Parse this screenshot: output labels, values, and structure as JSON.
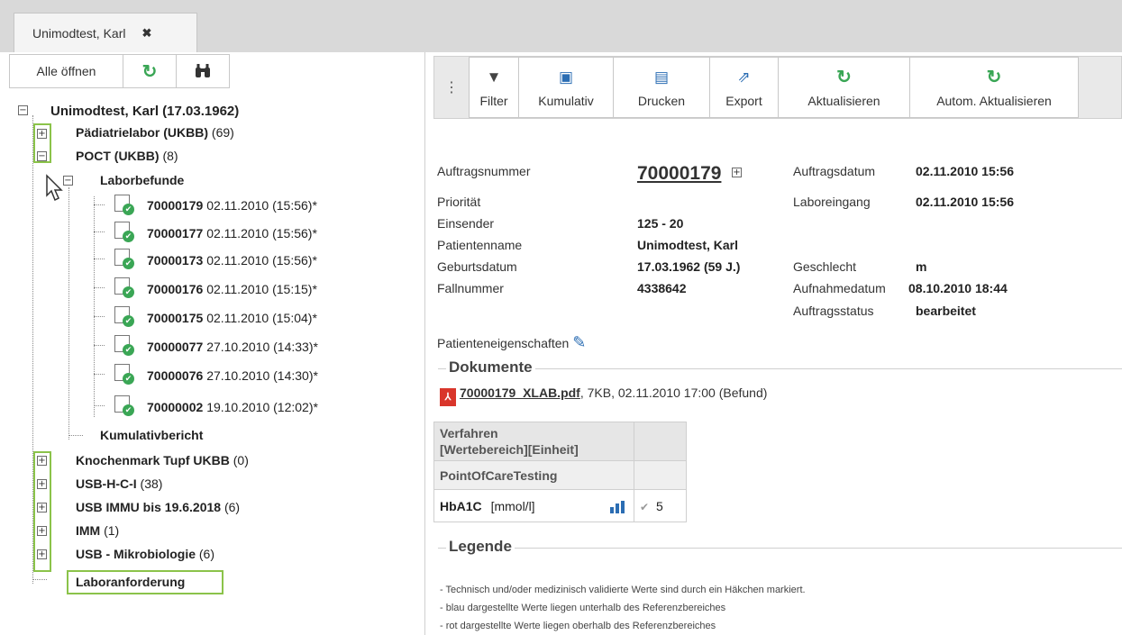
{
  "tab": {
    "title": "Unimodtest, Karl",
    "close": "✖"
  },
  "left_toolbar": {
    "open_all": "Alle öffnen",
    "refresh_icon": "refresh-icon",
    "search_icon": "binoculars-icon"
  },
  "tree": {
    "root": "Unimodtest, Karl (17.03.1962)",
    "groups": [
      {
        "label": "Pädiatrielabor (UKBB)",
        "count": "(69)"
      },
      {
        "label": "POCT (UKBB)",
        "count": "(8)"
      }
    ],
    "subfolder": "Laborbefunde",
    "orders": [
      {
        "id": "70000179",
        "date": "02.11.2010 (15:56)*"
      },
      {
        "id": "70000177",
        "date": "02.11.2010 (15:56)*"
      },
      {
        "id": "70000173",
        "date": "02.11.2010 (15:56)*"
      },
      {
        "id": "70000176",
        "date": "02.11.2010 (15:15)*"
      },
      {
        "id": "70000175",
        "date": "02.11.2010 (15:04)*"
      },
      {
        "id": "70000077",
        "date": "27.10.2010 (14:33)*"
      },
      {
        "id": "70000076",
        "date": "27.10.2010 (14:30)*"
      },
      {
        "id": "70000002",
        "date": "19.10.2010 (12:02)*"
      }
    ],
    "kumulativbericht": "Kumulativbericht",
    "more_groups": [
      {
        "label": "Knochenmark Tupf UKBB",
        "count": "(0)"
      },
      {
        "label": "USB-H-C-I",
        "count": "(38)"
      },
      {
        "label": "USB IMMU bis 19.6.2018",
        "count": "(6)"
      },
      {
        "label": "IMM",
        "count": "(1)"
      },
      {
        "label": "USB - Mikrobiologie",
        "count": "(6)"
      }
    ],
    "laboranforderung": "Laboranforderung"
  },
  "toolbar": {
    "filter": "Filter",
    "kumulativ": "Kumulativ",
    "drucken": "Drucken",
    "export": "Export",
    "aktualisieren": "Aktualisieren",
    "autom": "Autom. Aktualisieren"
  },
  "order": {
    "auftragsnummer_label": "Auftragsnummer",
    "auftragsnummer": "70000179",
    "auftragsdatum_label": "Auftragsdatum",
    "auftragsdatum": "02.11.2010 15:56",
    "prioritaet_label": "Priorität",
    "laboreingang_label": "Laboreingang",
    "laboreingang": "02.11.2010 15:56",
    "einsender_label": "Einsender",
    "einsender": "125 - 20",
    "patientenname_label": "Patientenname",
    "patientenname": "Unimodtest, Karl",
    "geburtsdatum_label": "Geburtsdatum",
    "geburtsdatum": "17.03.1962 (59 J.)",
    "geschlecht_label": "Geschlecht",
    "geschlecht": "m",
    "fallnummer_label": "Fallnummer",
    "fallnummer": "4338642",
    "aufnahmedatum_label": "Aufnahmedatum",
    "aufnahmedatum": "08.10.2010 18:44",
    "auftragsstatus_label": "Auftragsstatus",
    "auftragsstatus": "bearbeitet",
    "patienteneigenschaften": "Patienteneigenschaften"
  },
  "documents": {
    "title": "Dokumente",
    "file": "70000179_XLAB.pdf",
    "meta": ", 7KB, 02.11.2010 17:00 (Befund)"
  },
  "results": {
    "header_line1": "Verfahren",
    "header_line2": "[Wertebereich][Einheit]",
    "group": "PointOfCareTesting",
    "test_name": "HbA1C",
    "unit": "[mmol/l]",
    "value": "5"
  },
  "legend": {
    "title": "Legende",
    "lines": [
      "- Technisch und/oder medizinisch validierte Werte sind durch ein Häkchen markiert.",
      "- blau dargestellte Werte liegen unterhalb des Referenzbereiches",
      "- rot dargestellte Werte liegen oberhalb des Referenzbereiches"
    ]
  },
  "colors": {
    "highlight": "#8bc34a",
    "refresh": "#3aa655",
    "pdf": "#d9362b"
  }
}
